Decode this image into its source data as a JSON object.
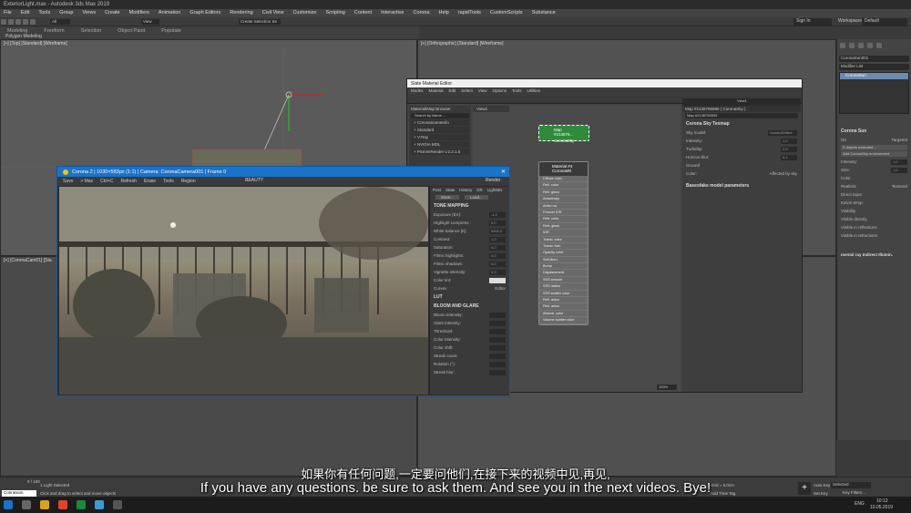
{
  "app_title": "ExteriorLight.max - Autodesk 3ds Max 2019",
  "menu": [
    "File",
    "Edit",
    "Tools",
    "Group",
    "Views",
    "Create",
    "Modifiers",
    "Animation",
    "Graph Editors",
    "Rendering",
    "Civil View",
    "Customize",
    "Scripting",
    "Content",
    "Interactive",
    "Corona",
    "Help",
    "rapidTools",
    "CustomScripts",
    "Substance"
  ],
  "toolbar": {
    "view_label": "View",
    "selection_set": "Create Selection Se",
    "filter": "All",
    "signin": "Sign In",
    "workspaces_label": "Workspaces:",
    "workspace_value": "Default"
  },
  "ribbon": {
    "tabs": [
      "Modeling",
      "Freeform",
      "Selection",
      "Object Paint",
      "Populate"
    ],
    "sub": "Polygon Modeling"
  },
  "viewports": {
    "top_left": "[+] [Top] [Standard] [Wireframe]",
    "top_right": "[+] [Orthographic] [Standard] [Wireframe]",
    "bottom_left": "[+] [CoronaCam01] [Sta"
  },
  "sme": {
    "title": "Slate Material Editor",
    "menu": [
      "Modes",
      "Material",
      "Edit",
      "Select",
      "View",
      "Options",
      "Tools",
      "Utilities"
    ],
    "browser_title": "Material/Map Browser",
    "search_placeholder": "Search by Name ...",
    "browser_items": [
      "+ CoronaSceneInfo",
      "+ Standard",
      "+ V-Ray",
      "+ NVIDIA MDL",
      "+ PSmimRender v.2.2.1.5"
    ],
    "view_tab": "View1",
    "view_dropdown": "View1",
    "node_sky": {
      "line1": "Map #213879...",
      "line2": "CoronaSky"
    },
    "node_mtl": {
      "line1": "Material #4",
      "line2": "CoronaMtl"
    },
    "mtl_slots": [
      "Diffuse color",
      "Refl. color",
      "Refl. gloss",
      "Anisotropy",
      "Aniso rot.",
      "Fresnel IOR",
      "Refr. color",
      "Refr. gloss",
      "IOR",
      "Transl. color",
      "Transl. frac.",
      "Opacity color",
      "Self-illum.",
      "Bump",
      "Displacement",
      "SSS amount",
      "SSS radius",
      "SSS scatter color",
      "Refl. aniso",
      "Refr. aniso",
      "Absorb. color",
      "Volume scatter color"
    ],
    "param_header": "Map #2138795595 ( CoronaSky )",
    "param_sub": "Map #2138795595",
    "rollout1": "Corona Sky Texmap",
    "sky_model_label": "Sky model:",
    "sky_model_value": "Hosek&Wilkie",
    "intensity_label": "Intensity:",
    "intensity_value": "1,0",
    "turbidity_label": "Turbidity:",
    "turbidity_value": "2,5",
    "horizon_label": "Horizon blur:",
    "horizon_value": "0,1",
    "ground_label": "Ground",
    "color_label": "Color:",
    "affected_label": "Affected by sky",
    "rollout2": "Basesfake model parameters",
    "zoom": "100%"
  },
  "vfb": {
    "title": "Corona 2 | 1030×583px (1:1) | Camera: CoronaCamera001 | Frame 0",
    "tools": [
      "Save",
      "> Max",
      "Ctrl+C",
      "Refresh",
      "Erase",
      "Tools",
      "Region"
    ],
    "beauty": "BEAUTY",
    "render_btn": "Render",
    "tabs": [
      "Post",
      "Stats",
      "History",
      "DR",
      "LightMix"
    ],
    "save_btn": "Save...",
    "load_btn": "Load...",
    "tone_header": "TONE MAPPING",
    "tone": [
      {
        "label": "Exposure (EV):",
        "value": "-1,0"
      },
      {
        "label": "Highlight compress.:",
        "value": "5,0"
      },
      {
        "label": "White balance [K]:",
        "value": "6500,0"
      },
      {
        "label": "Contrast:",
        "value": "1,0"
      },
      {
        "label": "Saturation:",
        "value": "0,0"
      },
      {
        "label": "Filmic highlights:",
        "value": "0,0"
      },
      {
        "label": "Filmic shadows:",
        "value": "0,0"
      },
      {
        "label": "Vignette intensity:",
        "value": "0,0"
      },
      {
        "label": "Color tint:",
        "value": ""
      }
    ],
    "curves": "Curves",
    "editor": "Editor",
    "lut_header": "LUT",
    "bloom_header": "BLOOM AND GLARE",
    "bloom": [
      "Bloom intensity:",
      "Glare intensity:",
      "Threshold:",
      "Color intensity:",
      "Color shift:",
      "Streak count:",
      "Rotation (°):",
      "Streak blur:"
    ]
  },
  "right_panel": {
    "name": "CoronaSun001",
    "modifier_list": "Modifier List",
    "stack_item": "CoronaSun",
    "sun_header": "Corona Sun",
    "on": "On",
    "targeted": "Targeted",
    "excluded": "0 objects excluded...",
    "add_env": "Add CoronaSky environment",
    "intensity_label": "Intensity:",
    "intensity_value": "1,0",
    "size_label": "Size:",
    "size_value": "1,0",
    "color_header": "Color",
    "realistic": "Realistic",
    "textured": "Textured",
    "direct_input": "Direct input",
    "kelvin": "Kelvin temp:",
    "visibility": "Visibility",
    "vis_directly": "Visible directly",
    "vis_refl": "Visible in reflections",
    "vis_refr": "Visible in refractions",
    "extra": "mental ray Indirect Illumin."
  },
  "status": {
    "frames": "0 / 100",
    "selected": "1 Light Selected",
    "hint": "Click and drag to select and move objects",
    "script": "Connexion",
    "grid": "Grid = 0,0cm",
    "autokey": "Auto Key",
    "selected_dd": "Selected",
    "setkey": "Set Key",
    "keyfilters": "Key Filters...",
    "addtime": "Add Time Tag"
  },
  "subtitles": {
    "zh": "如果你有任何问题,一定要问他们,在接下来的视频中见,再见,",
    "en": "If you have any questions. be sure to ask them. And see you in the next videos. Bye!"
  },
  "taskbar": {
    "time": "10:13",
    "date": "10.05.2019",
    "lang": "ENG"
  },
  "colors": {
    "corona_green": "#2f8a3a",
    "vfb_blue": "#1a73c8",
    "taskbar": "#1c1c1c"
  }
}
